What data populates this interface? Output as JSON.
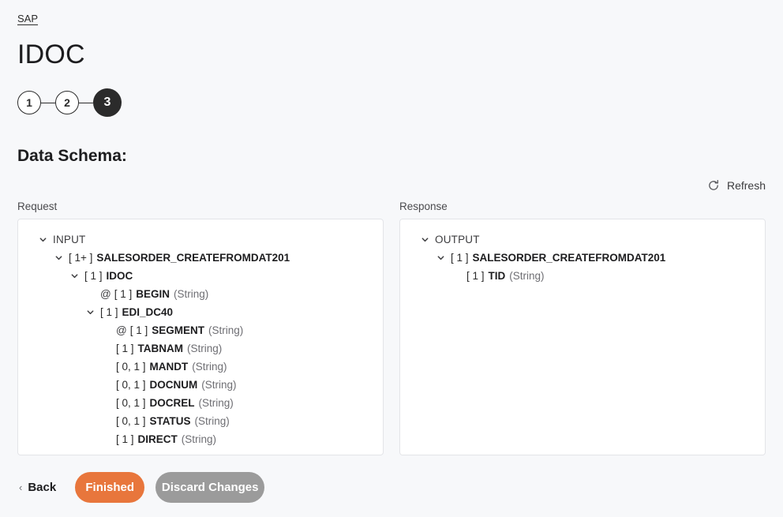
{
  "breadcrumb": {
    "label": "SAP"
  },
  "title": "IDOC",
  "stepper": {
    "steps": [
      {
        "label": "1",
        "active": false
      },
      {
        "label": "2",
        "active": false
      },
      {
        "label": "3",
        "active": true
      }
    ]
  },
  "section": {
    "title": "Data Schema:"
  },
  "toolbar": {
    "refresh_label": "Refresh",
    "refresh_icon": "refresh-icon"
  },
  "request": {
    "label": "Request",
    "nodes": [
      {
        "indent": 0,
        "chevron": "chevron-down-icon",
        "attr": "",
        "card": "",
        "name": "INPUT",
        "type": "",
        "root": true
      },
      {
        "indent": 1,
        "chevron": "chevron-down-icon",
        "attr": "",
        "card": "[ 1+ ]",
        "name": "SALESORDER_CREATEFROMDAT201",
        "type": "",
        "root": false
      },
      {
        "indent": 2,
        "chevron": "chevron-down-icon",
        "attr": "",
        "card": "[ 1 ]",
        "name": "IDOC",
        "type": "",
        "root": false
      },
      {
        "indent": 3,
        "chevron": "",
        "attr": "@",
        "card": "[ 1 ]",
        "name": "BEGIN",
        "type": "(String)",
        "root": false
      },
      {
        "indent": 3,
        "chevron": "chevron-down-icon",
        "attr": "",
        "card": "[ 1 ]",
        "name": "EDI_DC40",
        "type": "",
        "root": false
      },
      {
        "indent": 4,
        "chevron": "",
        "attr": "@",
        "card": "[ 1 ]",
        "name": "SEGMENT",
        "type": "(String)",
        "root": false
      },
      {
        "indent": 4,
        "chevron": "",
        "attr": "",
        "card": "[ 1 ]",
        "name": "TABNAM",
        "type": "(String)",
        "root": false
      },
      {
        "indent": 4,
        "chevron": "",
        "attr": "",
        "card": "[ 0, 1 ]",
        "name": "MANDT",
        "type": "(String)",
        "root": false
      },
      {
        "indent": 4,
        "chevron": "",
        "attr": "",
        "card": "[ 0, 1 ]",
        "name": "DOCNUM",
        "type": "(String)",
        "root": false
      },
      {
        "indent": 4,
        "chevron": "",
        "attr": "",
        "card": "[ 0, 1 ]",
        "name": "DOCREL",
        "type": "(String)",
        "root": false
      },
      {
        "indent": 4,
        "chevron": "",
        "attr": "",
        "card": "[ 0, 1 ]",
        "name": "STATUS",
        "type": "(String)",
        "root": false
      },
      {
        "indent": 4,
        "chevron": "",
        "attr": "",
        "card": "[ 1 ]",
        "name": "DIRECT",
        "type": "(String)",
        "root": false
      }
    ]
  },
  "response": {
    "label": "Response",
    "nodes": [
      {
        "indent": 0,
        "chevron": "chevron-down-icon",
        "attr": "",
        "card": "",
        "name": "OUTPUT",
        "type": "",
        "root": true
      },
      {
        "indent": 1,
        "chevron": "chevron-down-icon",
        "attr": "",
        "card": "[ 1 ]",
        "name": "SALESORDER_CREATEFROMDAT201",
        "type": "",
        "root": false
      },
      {
        "indent": 2,
        "chevron": "",
        "attr": "",
        "card": "[ 1 ]",
        "name": "TID",
        "type": "(String)",
        "root": false
      }
    ]
  },
  "footer": {
    "back_label": "Back",
    "back_chevron": "‹",
    "finished_label": "Finished",
    "discard_label": "Discard Changes"
  },
  "colors": {
    "page_background": "#f7f8fa",
    "panel_background": "#ffffff",
    "panel_border": "#e3e4e8",
    "primary_button": "#e8763c",
    "secondary_button": "#9b9b9b",
    "step_active": "#2b2b2b",
    "text": "#1d1d1f",
    "muted_text": "#6e6e73"
  }
}
